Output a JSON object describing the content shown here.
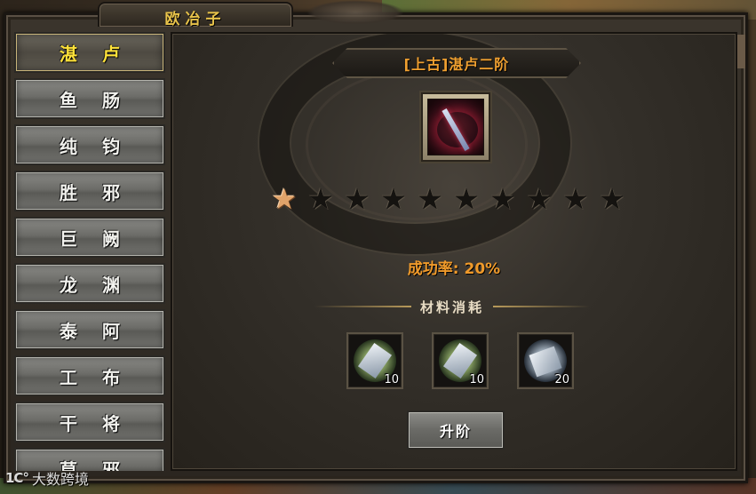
{
  "window": {
    "title": "欧冶子"
  },
  "sidebar": {
    "items": [
      {
        "label": "湛卢",
        "active": true
      },
      {
        "label": "鱼肠"
      },
      {
        "label": "纯钧"
      },
      {
        "label": "胜邪"
      },
      {
        "label": "巨阙"
      },
      {
        "label": "龙渊"
      },
      {
        "label": "泰阿"
      },
      {
        "label": "工布"
      },
      {
        "label": "干将"
      },
      {
        "label": "莫邪"
      }
    ]
  },
  "detail": {
    "item_name": "[上古]湛卢二阶",
    "stars_total": 10,
    "stars_lit": 1,
    "success_rate": "成功率: 20%",
    "materials_title": "材料消耗",
    "materials": [
      {
        "icon": "axe-material-icon",
        "count": "10"
      },
      {
        "icon": "spear-material-icon",
        "count": "10"
      },
      {
        "icon": "crystal-material-icon",
        "count": "20"
      }
    ],
    "upgrade_label": "升阶"
  },
  "watermark": {
    "logo": "1C°",
    "text": "大数跨境"
  },
  "colors": {
    "title": "#e8c34a",
    "active_item": "#ffe23a",
    "rate": "#f09a2a",
    "item_name": "#f0a030",
    "lit_star": "#e0a36a"
  }
}
